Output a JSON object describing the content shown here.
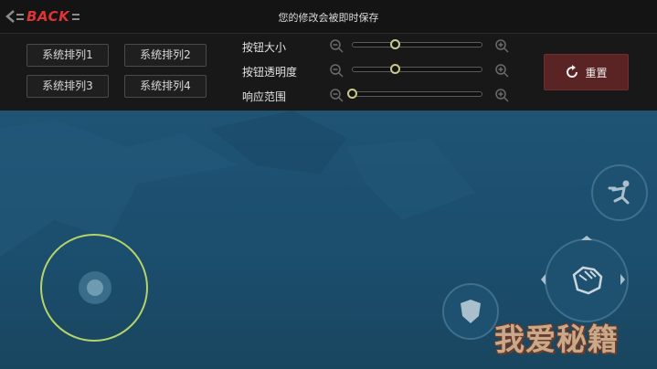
{
  "header": {
    "back_label": "BACK",
    "title": "您的修改会被即时保存"
  },
  "layouts": [
    {
      "label": "系统排列1"
    },
    {
      "label": "系统排列2"
    },
    {
      "label": "系统排列3"
    },
    {
      "label": "系统排列4"
    }
  ],
  "sliders": [
    {
      "label": "按钮大小",
      "value": 0.33
    },
    {
      "label": "按钮透明度",
      "value": 0.33
    },
    {
      "label": "响应范围",
      "value": 0.0
    }
  ],
  "reset": {
    "label": "重置"
  },
  "controls": {
    "joystick": "virtual-joystick",
    "jump": "jump-icon",
    "attack": "fist-icon",
    "defend": "shield-icon"
  },
  "watermark": {
    "text": "我爱秘籍"
  },
  "colors": {
    "accent_red": "#e03434",
    "reset_bg": "#5a2424",
    "game_bg": "#1d5070",
    "joystick_ring": "#b5d36a",
    "slider_knob": "#c9c98a"
  }
}
